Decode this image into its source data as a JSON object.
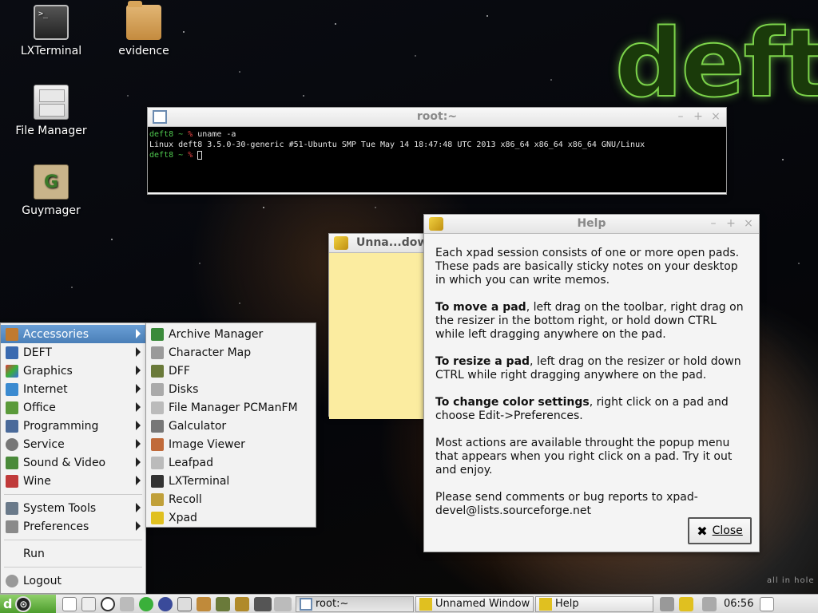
{
  "desktop": {
    "icons": [
      {
        "label": "LXTerminal"
      },
      {
        "label": "evidence"
      },
      {
        "label": "File Manager"
      },
      {
        "label": "Guymager"
      }
    ],
    "logo_text": "deft",
    "corner_text": "all in hole"
  },
  "terminal": {
    "title": "root:~",
    "lines": {
      "prompt_host": "deft8",
      "prompt_tilde": "~",
      "prompt_symbol": "%",
      "cmd1": "uname -a",
      "output1": "Linux deft8 3.5.0-30-generic #51-Ubuntu SMP Tue May 14 18:47:48 UTC 2013 x86_64 x86_64 x86_64 GNU/Linux"
    }
  },
  "pad_window": {
    "title": "Unna...dow"
  },
  "help_window": {
    "title": "Help",
    "p1": "Each xpad session consists of one or more open pads. These pads are basically sticky notes on your desktop in which you can write memos.",
    "p2_bold": "To move a pad",
    "p2_rest": ", left drag on the toolbar, right drag on the resizer in the bottom right, or hold down CTRL while left dragging anywhere on the pad.",
    "p3_bold": "To resize a pad",
    "p3_rest": ", left drag on the resizer or hold down CTRL while right dragging anywhere on the pad.",
    "p4_bold": "To change color settings",
    "p4_rest": ", right click on a pad and choose Edit->Preferences.",
    "p5": "Most actions are available throught the popup menu that appears when you right click on a pad.  Try it out and enjoy.",
    "p6": "Please send comments or bug reports to xpad-devel@lists.sourceforge.net",
    "close_label": "Close"
  },
  "main_menu": {
    "items": [
      {
        "label": "Accessories",
        "color": "#c07a30"
      },
      {
        "label": "DEFT",
        "color": "#3a6ab0"
      },
      {
        "label": "Graphics",
        "color": "#d04a8a"
      },
      {
        "label": "Internet",
        "color": "#3a8ad0"
      },
      {
        "label": "Office",
        "color": "#5a9a3a"
      },
      {
        "label": "Programming",
        "color": "#4a6a9a"
      },
      {
        "label": "Service",
        "color": "#777777"
      },
      {
        "label": "Sound & Video",
        "color": "#4a8a3a"
      },
      {
        "label": "Wine",
        "color": "#c03a3a"
      }
    ],
    "system_tools": "System Tools",
    "preferences": "Preferences",
    "run": "Run",
    "logout": "Logout"
  },
  "accessories_menu": {
    "items": [
      {
        "label": "Archive Manager",
        "color": "#3a8a3a"
      },
      {
        "label": "Character Map",
        "color": "#9a9a9a"
      },
      {
        "label": "DFF",
        "color": "#6a7a3a"
      },
      {
        "label": "Disks",
        "color": "#aaaaaa"
      },
      {
        "label": "File Manager PCManFM",
        "color": "#bbbbbb"
      },
      {
        "label": "Galculator",
        "color": "#777777"
      },
      {
        "label": "Image Viewer",
        "color": "#c06a3a"
      },
      {
        "label": "Leafpad",
        "color": "#bbbbbb"
      },
      {
        "label": "LXTerminal",
        "color": "#333333"
      },
      {
        "label": "Recoll",
        "color": "#c0a03a"
      },
      {
        "label": "Xpad",
        "color": "#e0c020"
      }
    ]
  },
  "taskbar": {
    "start_letter": "d",
    "tasks": [
      {
        "label": "root:~"
      },
      {
        "label": "Unnamed Window"
      },
      {
        "label": "Help"
      }
    ],
    "clock": "06:56"
  }
}
